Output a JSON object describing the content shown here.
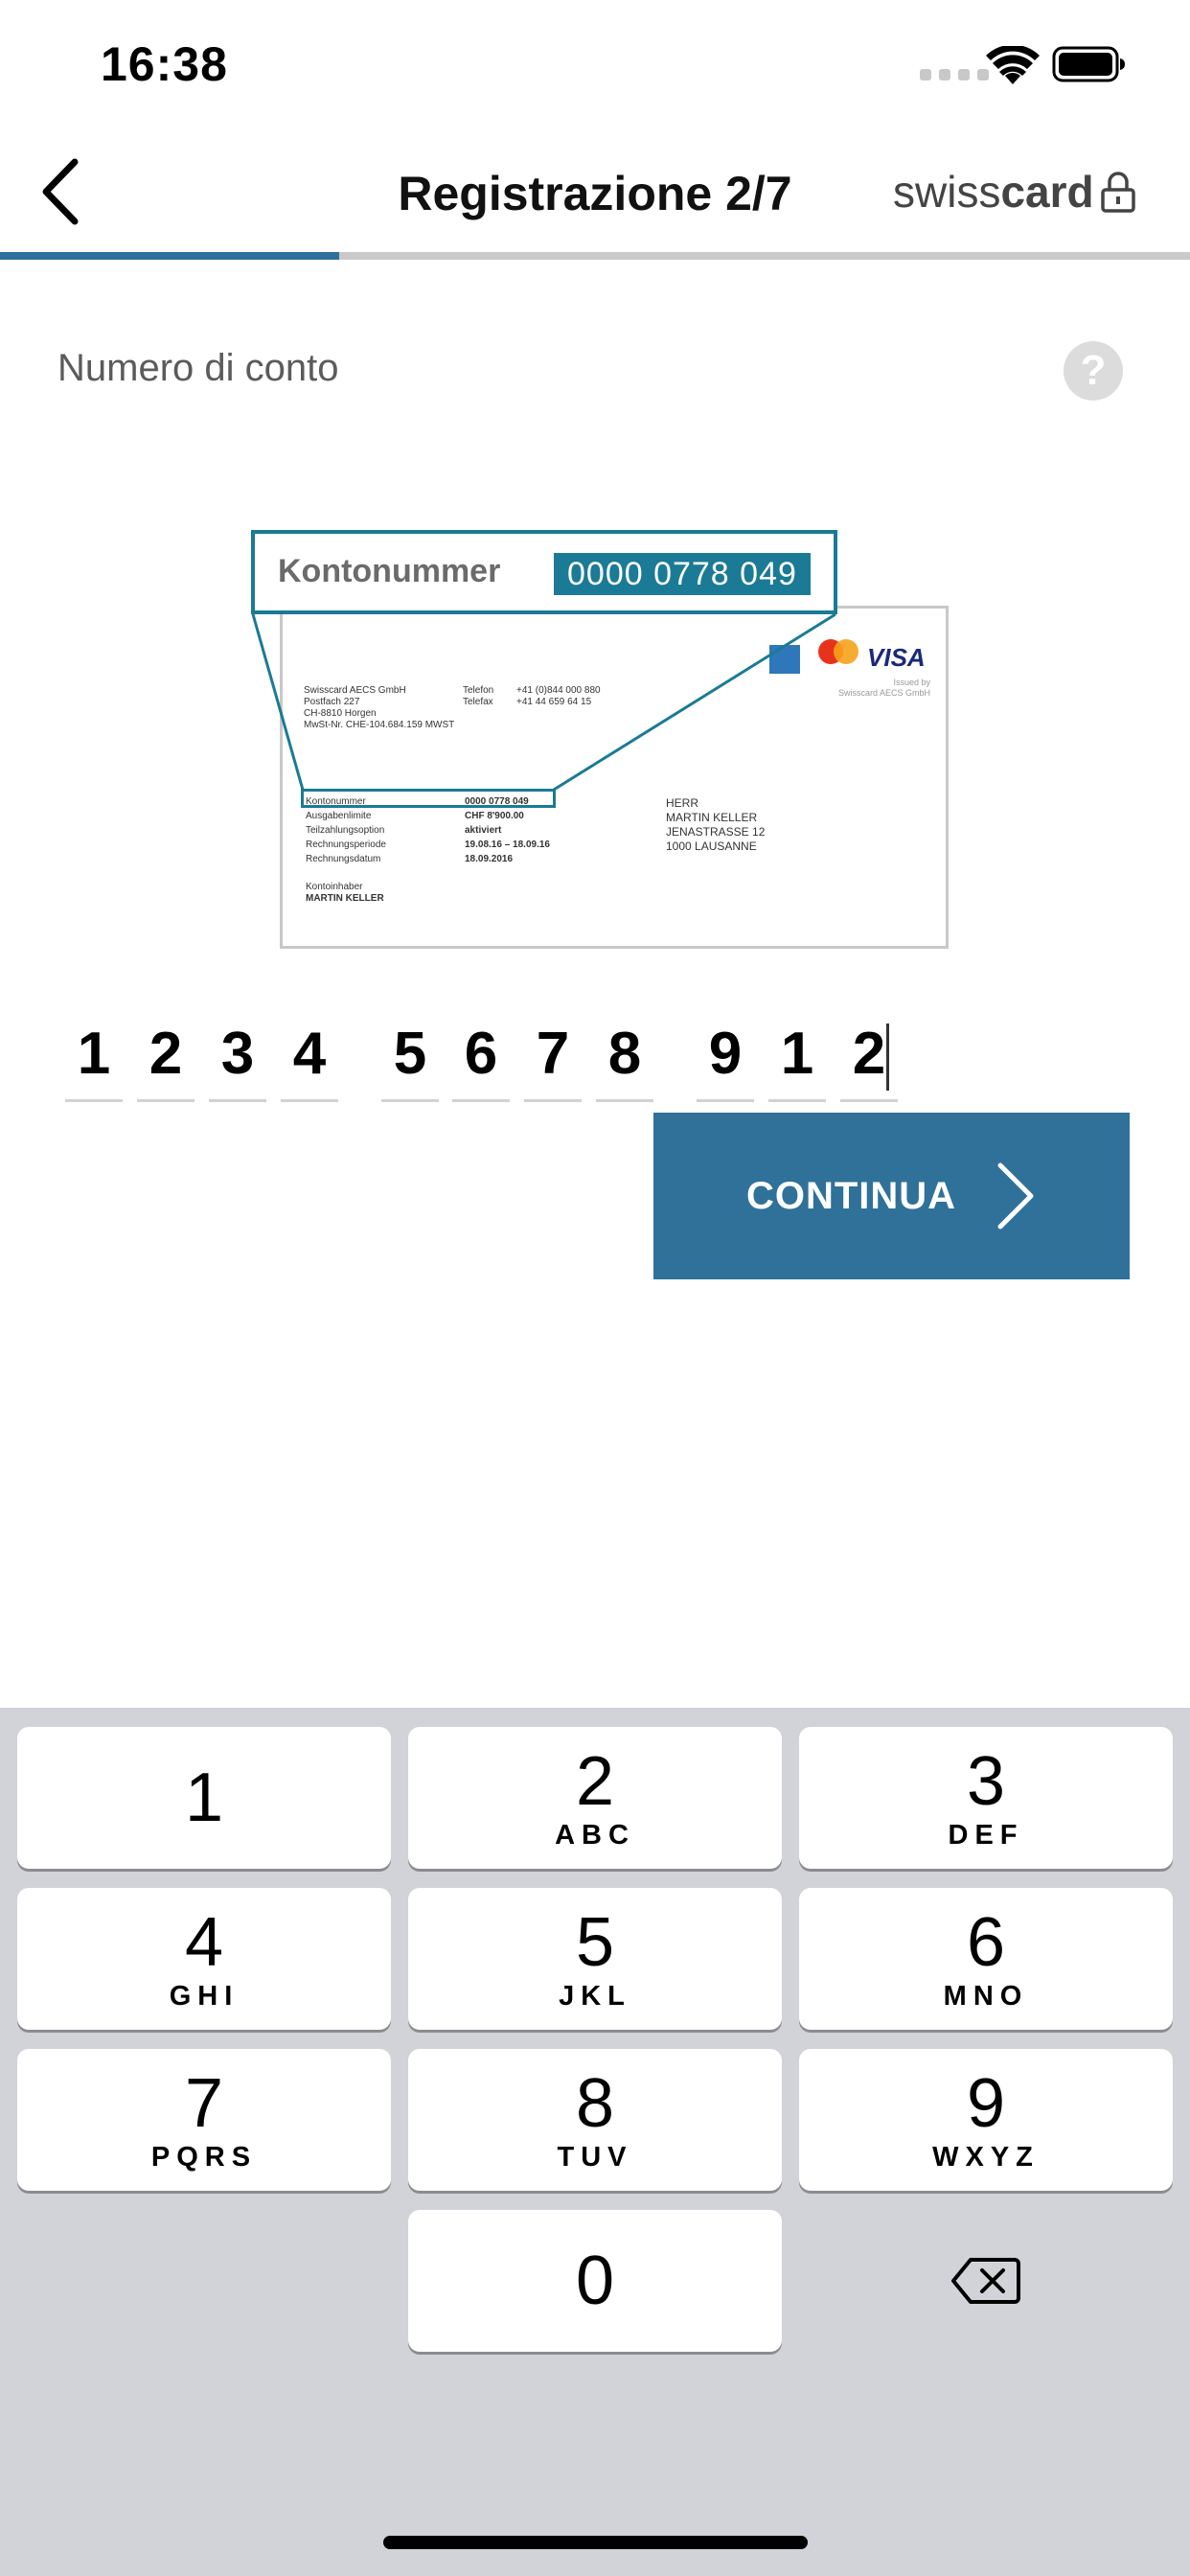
{
  "status_bar": {
    "time": "16:38"
  },
  "nav": {
    "title": "Registrazione 2/7",
    "brand_light": "swiss",
    "brand_bold": "card",
    "progress": 0.285
  },
  "form": {
    "field_label": "Numero di conto",
    "help_label": "?",
    "digits": [
      "1",
      "2",
      "3",
      "4",
      "5",
      "6",
      "7",
      "8",
      "9",
      "1",
      "2"
    ],
    "continue_label": "CONTINUA"
  },
  "illustration": {
    "callout_label": "Kontonummer",
    "callout_number": "0000 0778 049",
    "sender_block": "Swisscard AECS GmbH\nPostfach 227\nCH-8810 Horgen\nMwSt-Nr. CHE-104.684.159 MWST",
    "contact_labels": "Telefon\nTelefax",
    "contact_values": "+41 (0)844 000 880\n+41 44 659 64 15",
    "based_by": "Issued by\nSwisscard AECS GmbH",
    "account_labels": "Kontonummer\nAusgabenlimite\nTeilzahlungsoption\nRechnungsperiode\nRechnungsdatum",
    "account_values": "0000 0778 049\nCHF 8'900.00\naktiviert\n19.08.16 – 18.09.16\n18.09.2016",
    "holder_label": "Kontoinhaber",
    "holder_name": "MARTIN KELLER",
    "address": "HERR\nMARTIN KELLER\nJENASTRASSE 12\n1000 LAUSANNE",
    "visa": "VISA"
  },
  "keyboard": {
    "keys": [
      {
        "digit": "1",
        "letters": ""
      },
      {
        "digit": "2",
        "letters": "ABC"
      },
      {
        "digit": "3",
        "letters": "DEF"
      },
      {
        "digit": "4",
        "letters": "GHI"
      },
      {
        "digit": "5",
        "letters": "JKL"
      },
      {
        "digit": "6",
        "letters": "MNO"
      },
      {
        "digit": "7",
        "letters": "PQRS"
      },
      {
        "digit": "8",
        "letters": "TUV"
      },
      {
        "digit": "9",
        "letters": "WXYZ"
      },
      {
        "digit": "0",
        "letters": ""
      }
    ]
  },
  "colors": {
    "accent": "#2f7199",
    "callout": "#1b7a95",
    "keyboard_bg": "#d1d3d9"
  }
}
